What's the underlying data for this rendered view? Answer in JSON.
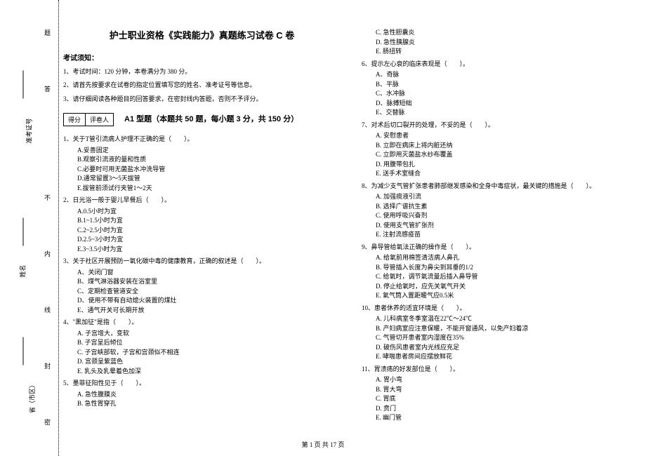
{
  "gutter": {
    "labels": [
      "省（市区）",
      "姓名",
      "准考证号"
    ],
    "chars": [
      "密",
      "封",
      "线",
      "内",
      "不",
      "答",
      "题"
    ]
  },
  "title": "护士职业资格《实践能力》真题练习试卷 C 卷",
  "notice_header": "考试须知：",
  "instructions": [
    "1、考试时间：120 分钟，本卷满分为 380 分。",
    "2、请首先按要求在试卷的指定位置填写您的姓名、准考证号等信息。",
    "3、请仔细阅读各种题目的回答要求，在密封线内答题，否则不予评分。"
  ],
  "score_labels": [
    "得分",
    "评卷人"
  ],
  "section_a1": "A1 型题（本题共 50 题，每小题 3 分，共 150 分）",
  "left_questions": [
    {
      "q": "1、关于T管引流病人护理不正确的是（　　）。",
      "opts": [
        "A.妥善固定",
        "B.观察引流液的量和性质",
        "C.必要时可用无菌盐水冲洗导管",
        "D.通常留置3～5天拔管",
        "E.拔管前须试行夹管1～2天"
      ]
    },
    {
      "q": "2、日光浴一般于婴儿早餐后（　　）。",
      "opts": [
        "A.0.5小时为宜",
        "B.1~1.5小时为宜",
        "C.2~2.5小时为宜",
        "D.2.5~3小时为宜",
        "E.3~3.5小时为宜"
      ]
    },
    {
      "q": "3、关于社区开展预防一氧化碳中毒的健康教育，正确的叙述是（　　）。",
      "opts": [
        "A、关闭门窗",
        "B、煤气淋浴器安装在浴室里",
        "C、定期检查管道安全",
        "D、使用不带有自动熄火装置的煤灶",
        "E、通气开关可长期开放"
      ]
    },
    {
      "q": "4、\"黑加征\"是指（　　）。",
      "opts": [
        "A. 子宫增大，变软",
        "B. 子宫呈后倾位",
        "C. 子宫峡部软，子宫和宫颈似不相连",
        "D. 宫颈呈紫蓝色",
        "E. 乳头及乳晕着色加深"
      ]
    },
    {
      "q": "5、墨菲征阳性见于（　　）。",
      "opts": [
        "A. 急性腹膜炎",
        "B. 急性胃穿孔"
      ]
    }
  ],
  "right_continuation": [
    "C. 急性胆囊炎",
    "D. 急性胰腺炎",
    "E. 肠扭转"
  ],
  "right_questions": [
    {
      "q": "6、提示左心衰的临床表现是（　　）。",
      "opts": [
        "A、奇脉",
        "B、平脉",
        "C、水冲脉",
        "D、脉搏短绌",
        "E、交替脉"
      ]
    },
    {
      "q": "7、对术后切口裂开的处理，不妥的是（　　）。",
      "opts": [
        "A. 安慰患者",
        "B. 立即在病床上将内脏还纳",
        "C. 立即用灭菌盐水纱布覆盖",
        "D. 用腹带包扎",
        "E. 送手术室缝合"
      ]
    },
    {
      "q": "8、为减少支气管扩张患者肺部继发感染和全身中毒症状，最关键的措施是（　　）。",
      "opts": [
        "A. 加强痰液引流",
        "B. 选择广谱抗生素",
        "C. 使用呼吸兴奋剂",
        "D. 使用支气管扩张剂",
        "E. 注射流感疫苗"
      ]
    },
    {
      "q": "9、鼻导管给氧法正确的操作是（　　）。",
      "opts": [
        "A. 给氧前用棉签清洁病人鼻孔",
        "B. 导管插入长度为鼻尖到耳垂的1/2",
        "C. 给氧时，调节氧流量后插入鼻导管",
        "D. 停止给氧时，应先关氧气开关",
        "E. 氧气筒入置距暖气应0.5米"
      ]
    },
    {
      "q": "10、患者休养的适宜环境是（　　）。",
      "opts": [
        "A. 儿科病室冬季室温在22℃～24℃",
        "B. 产妇病室应注意保暖，不能开窗通风，以免产妇着凉",
        "C. 气管切开患者室内湿度在35%",
        "D. 破伤风患者室内光线应充足",
        "E. 哮喘患者房间应摆放鲜花"
      ]
    },
    {
      "q": "11、胃溃疡的好发部位是（　　）。",
      "opts": [
        "A. 胃小弯",
        "B. 胃大弯",
        "C. 胃底",
        "D. 贲门",
        "E. 幽门管"
      ]
    }
  ],
  "footer": "第 1 页 共 17 页"
}
